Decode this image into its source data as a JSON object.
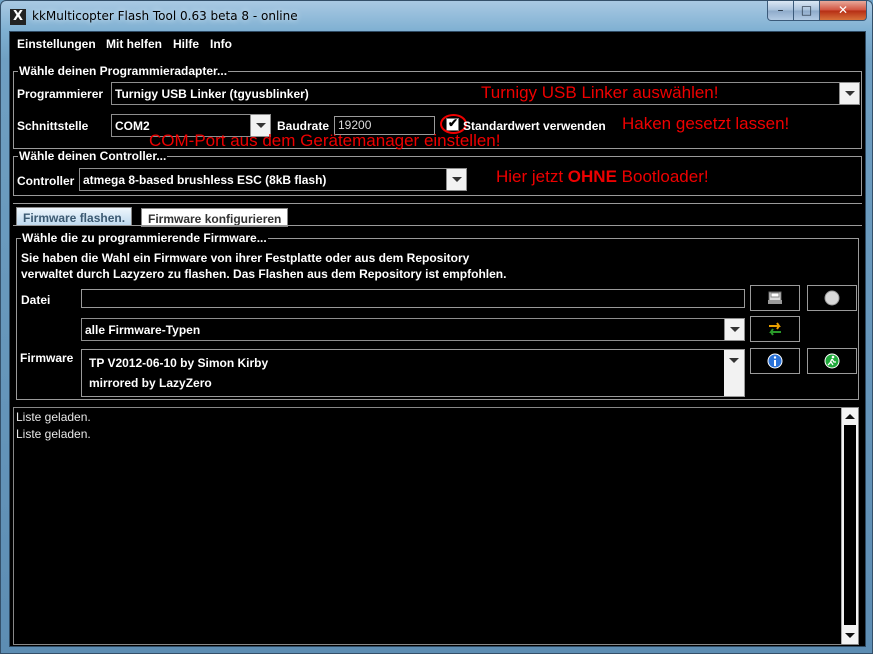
{
  "window": {
    "title": "kkMulticopter Flash Tool 0.63 beta 8 - online",
    "app_icon_glyph": "X",
    "minimize_glyph": "–",
    "maximize_glyph": "□",
    "close_glyph": "✕"
  },
  "menu": {
    "items": [
      {
        "label": "Einstellungen"
      },
      {
        "label": "Mit helfen"
      },
      {
        "label": "Hilfe"
      },
      {
        "label": "Info"
      }
    ]
  },
  "programmer_group": {
    "legend": "Wähle deinen Programmieradapter...",
    "programmer_label": "Programmierer",
    "programmer_value": "Turnigy USB Linker (tgyusblinker)",
    "port_label": "Schnittstelle",
    "port_value": "COM2",
    "baud_label": "Baudrate",
    "baud_value": "19200",
    "default_checkbox_checked": true,
    "default_checkbox_label": "Standardwert verwenden"
  },
  "controller_group": {
    "legend": "Wähle deinen Controller...",
    "controller_label": "Controller",
    "controller_value": "atmega 8-based brushless ESC (8kB flash)"
  },
  "annotations": {
    "select_linker": "Turnigy USB Linker auswählen!",
    "keep_checked": "Haken gesetzt lassen!",
    "com_port": "COM-Port aus dem Gerätemanager einstellen!",
    "no_bootloader_pre": "Hier jetzt ",
    "no_bootloader_bold": "OHNE",
    "no_bootloader_post": " Bootloader!"
  },
  "tabs": [
    {
      "label": "Firmware flashen.",
      "active": true
    },
    {
      "label": "Firmware konfigurieren",
      "active": false
    }
  ],
  "firmware_group": {
    "legend": "Wähle die zu programmierende Firmware...",
    "description_line1": "Sie haben die Wahl ein Firmware von ihrer Festplatte oder aus dem Repository",
    "description_line2": "verwaltet durch Lazyzero zu flashen. Das Flashen aus dem Repository ist empfohlen.",
    "file_label": "Datei",
    "file_value": "",
    "firmware_label": "Firmware",
    "type_filter_value": "alle Firmware-Typen",
    "firmware_list": [
      "TP V2012-06-10  by Simon Kirby",
      "mirrored by LazyZero"
    ]
  },
  "log": {
    "lines": [
      "Liste geladen.",
      "Liste geladen."
    ]
  },
  "colors": {
    "annotation": "#e00000",
    "background": "#000000",
    "foreground": "#ffffff",
    "active_tab": "#bcd8ee"
  },
  "icons": {
    "save": "save-disk-icon",
    "clear": "grey-circle-icon",
    "refresh": "refresh-arrows-icon",
    "info": "info-icon",
    "run": "run-green-icon"
  }
}
